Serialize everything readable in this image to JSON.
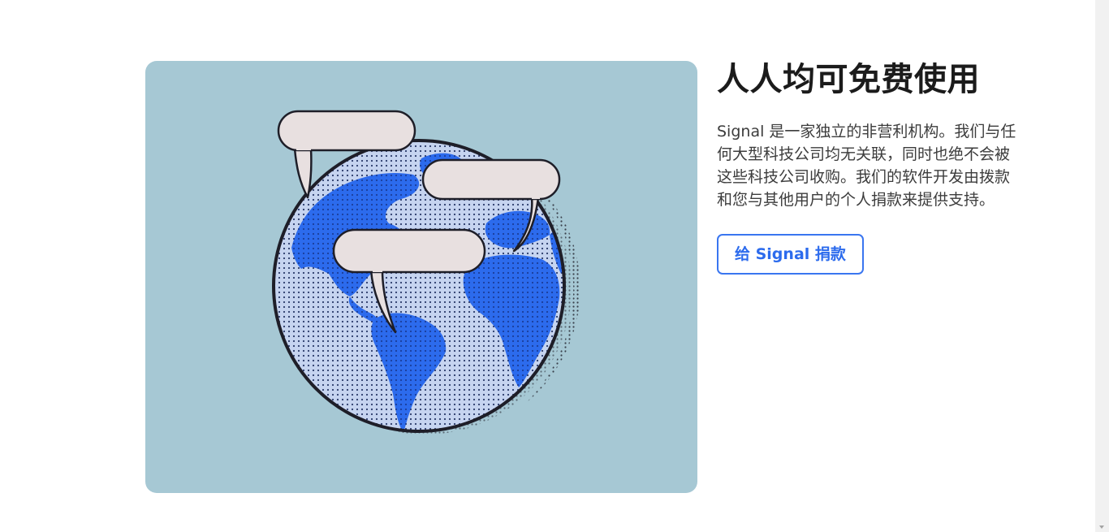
{
  "section": {
    "heading": "人人均可免费使用",
    "description": "Signal 是一家独立的非营利机构。我们与任何大型科技公司均无关联，同时也绝不会被这些科技公司收购。我们的软件开发由拨款和您与其他用户的个人捐款来提供支持。",
    "donate_button_label": "给 Signal 捐款"
  },
  "colors": {
    "illustration_background": "#a6c8d4",
    "globe_ocean": "#c6d4f0",
    "globe_land": "#2c6bed",
    "speech_bubble": "#e8e0e0",
    "outline": "#1e1e28",
    "button_accent": "#3a76f0"
  },
  "illustration": {
    "icon": "globe-with-speech-bubbles-icon"
  }
}
